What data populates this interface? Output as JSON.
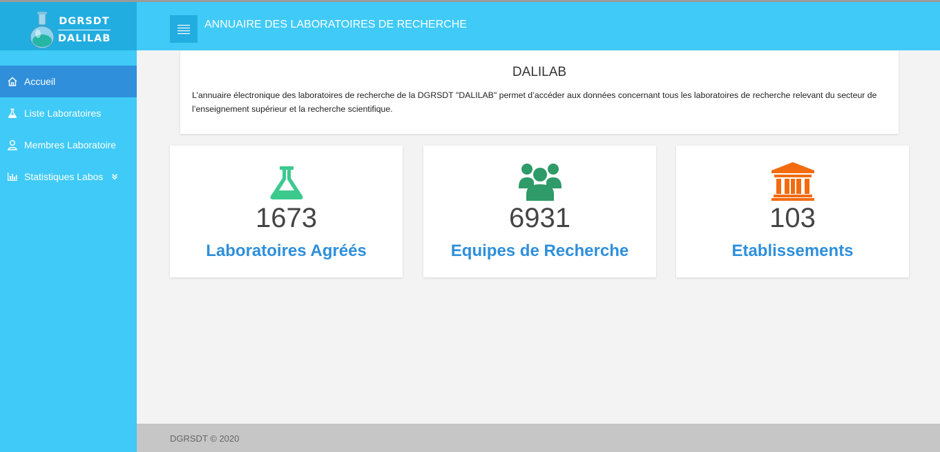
{
  "brand": {
    "line1": "DGRSDT",
    "line2": "DALILAB"
  },
  "sidebar": {
    "items": [
      {
        "label": "Accueil",
        "icon": "home-icon"
      },
      {
        "label": "Liste Laboratoires",
        "icon": "flask-icon"
      },
      {
        "label": "Membres Laboratoire",
        "icon": "user-icon"
      },
      {
        "label": "Statistiques Labos",
        "icon": "bar-chart-icon"
      }
    ]
  },
  "header": {
    "title": "ANNUAIRE DES LABORATOIRES DE RECHERCHE"
  },
  "intro": {
    "title": "DALILAB",
    "text": "L’annuaire électronique des laboratoires de recherche de la DGRSDT \"DALILAB\" permet d’accéder aux données concernant tous les laboratoires de recherche relevant du secteur de l’enseignement supérieur et la recherche scientifique."
  },
  "stats": [
    {
      "value": "1673",
      "label": "Laboratoires Agréés",
      "icon": "flask-icon",
      "color": "#3cc98e"
    },
    {
      "value": "6931",
      "label": "Equipes de Recherche",
      "icon": "users-icon",
      "color": "#2e9b68"
    },
    {
      "value": "103",
      "label": "Etablissements",
      "icon": "institution-icon",
      "color": "#f26b0f"
    }
  ],
  "footer": {
    "text": "DGRSDT © 2020"
  },
  "colors": {
    "primary": "#3fcaf7",
    "dark": "#22ade0",
    "active": "#2f8fdb",
    "label": "#2e8fdb"
  }
}
